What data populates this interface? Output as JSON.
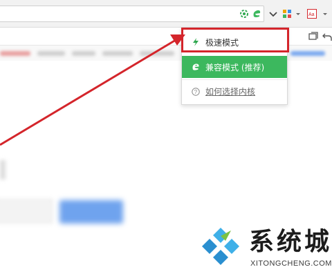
{
  "menu": {
    "items": [
      {
        "label": "极速模式",
        "icon": "lightning-icon"
      },
      {
        "label": "兼容模式 (推荐)",
        "icon": "ie-icon"
      },
      {
        "label": "如何选择内核",
        "icon": "help-circle-icon"
      }
    ],
    "selected_color": "#3cb85e"
  },
  "annotation": {
    "color": "#d4252b"
  },
  "watermark": {
    "title": "系统城",
    "subtitle": "XITONGCHENG.COM"
  }
}
